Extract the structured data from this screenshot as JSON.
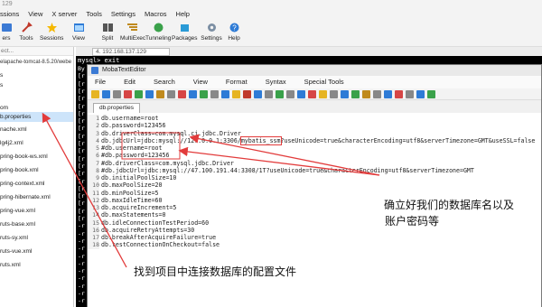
{
  "window": {
    "title": "129"
  },
  "menubar": [
    "ssions",
    "View",
    "X server",
    "Tools",
    "Settings",
    "Macros",
    "Help"
  ],
  "toolbar": [
    {
      "label": "ers",
      "icon": "servers-icon"
    },
    {
      "label": "Tools",
      "icon": "tools-icon"
    },
    {
      "label": "Sessions",
      "icon": "sessions-icon"
    },
    {
      "label": "View",
      "icon": "view-icon"
    },
    {
      "label": "Split",
      "icon": "split-icon"
    },
    {
      "label": "MultiExec",
      "icon": "multiexec-icon"
    },
    {
      "label": "Tunneling",
      "icon": "tunneling-icon"
    },
    {
      "label": "Packages",
      "icon": "packages-icon"
    },
    {
      "label": "Settings",
      "icon": "settings-icon"
    },
    {
      "label": "Help",
      "icon": "help-icon"
    }
  ],
  "sidebar": {
    "search": "ect...",
    "path": "elapache-tomcat-8.5.20/webe",
    "items": [
      "s",
      "s",
      "om",
      "b.properties",
      "nache.xml",
      "lg4j2.xml",
      "pring-book-ws.xml",
      "pring-book.xml",
      "pring-context.xml",
      "pring-hibernate.xml",
      "pring-vue.xml",
      "ruts-base.xml",
      "ruts-sy.xml",
      "ruts-vue.xml",
      "ruts.xml"
    ]
  },
  "terminal": {
    "tab": "4. 192.168.137.129",
    "line": "mysql> exit",
    "row_prefixes": [
      "By",
      "[r",
      "[r",
      "[r",
      "[r",
      "[r",
      "[r",
      "[r",
      "[r",
      "[r",
      "[r",
      "[r",
      "[r",
      "[r",
      "[r",
      "[r",
      "[r",
      "[r",
      "[r",
      "[r",
      "[r",
      "-r",
      "-r",
      "-r",
      "-r",
      "-r",
      "-r",
      "-r",
      "-r",
      "-r",
      "-r",
      "-r",
      "-r"
    ]
  },
  "editor": {
    "title": "MobaTextEditor",
    "menu": [
      "File",
      "Edit",
      "Search",
      "View",
      "Format",
      "Syntax",
      "Special Tools"
    ],
    "file_tab": "db.properties",
    "lines": [
      "db.username=root",
      "db.password=123456",
      "db.driverClass=com.mysql.cj.jdbc.Driver",
      "db.jdbcUrl=jdbc:mysql://127.0.0.1:3306/mybatis_ssm?useUnicode=true&characterEncoding=utf8&serverTimezone=GMT&useSSL=false",
      "#db.username=root",
      "#db.password=123456",
      "#db.driverClass=com.mysql.jdbc.Driver",
      "#db.jdbcUrl=jdbc:mysql://47.100.191.44:3308/1T?useUnicode=true&characterEncoding=utf8&serverTimezone=GMT",
      "db.initialPoolSize=10",
      "db.maxPoolSize=20",
      "db.minPoolSize=5",
      "db.maxIdleTime=60",
      "db.acquireIncrement=5",
      "db.maxStatements=0",
      "db.idleConnectionTestPeriod=60",
      "db.acquireRetryAttempts=30",
      "db.breakAfterAcquireFailure=true",
      "db.testConnectionOnCheckout=false"
    ]
  },
  "annotations": {
    "db_name": "确立好我们的数据库名以及",
    "db_name_line2": "账户密码等",
    "config_file": "找到项目中连接数据库的配置文件"
  },
  "colors": {
    "annotation_red": "#e23b3b",
    "terminal_bg": "#000000",
    "selection": "#cde4fa"
  }
}
